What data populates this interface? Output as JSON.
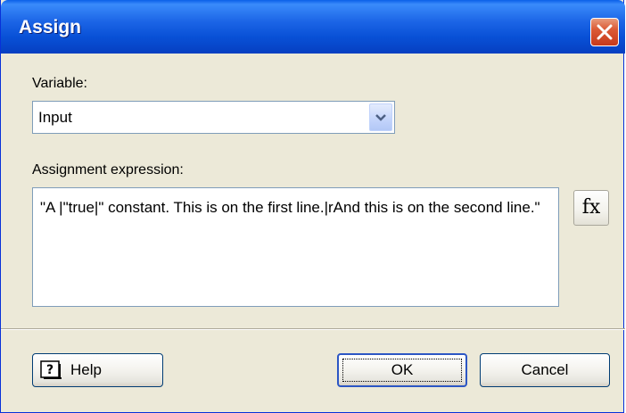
{
  "window": {
    "title": "Assign"
  },
  "variable": {
    "label": "Variable:",
    "selected": "Input"
  },
  "expression": {
    "label": "Assignment expression:",
    "value": "\"A |\"true|\" constant. This is on the first line.|rAnd this is on the second line.\"",
    "fx_label": "fx"
  },
  "buttons": {
    "help": "Help",
    "ok": "OK",
    "cancel": "Cancel"
  },
  "icons": {
    "close": "close-icon",
    "dropdown": "chevron-down-icon",
    "help": "help-icon",
    "function": "function-icon"
  },
  "colors": {
    "titlebar": "#0a5fe8",
    "dialog_bg": "#ece9d8",
    "close_button": "#c63a1c",
    "input_border": "#7f9db9"
  }
}
